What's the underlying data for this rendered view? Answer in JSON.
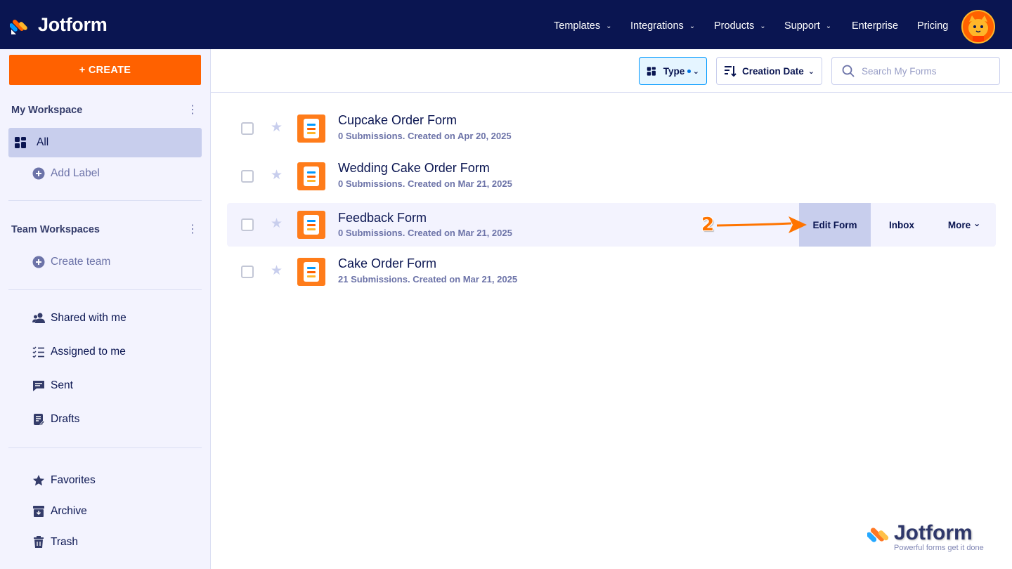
{
  "app": {
    "brand": "Jotform"
  },
  "nav": {
    "items": [
      {
        "label": "Templates",
        "has_dropdown": true
      },
      {
        "label": "Integrations",
        "has_dropdown": true
      },
      {
        "label": "Products",
        "has_dropdown": true
      },
      {
        "label": "Support",
        "has_dropdown": true
      },
      {
        "label": "Enterprise",
        "has_dropdown": false
      },
      {
        "label": "Pricing",
        "has_dropdown": false
      }
    ],
    "avatar_icon": "user-avatar"
  },
  "sidebar": {
    "create_label": "+ CREATE",
    "my_workspace": {
      "title": "My Workspace",
      "all_label": "All",
      "add_label": "Add Label"
    },
    "team_workspaces": {
      "title": "Team Workspaces",
      "create_team_label": "Create team"
    },
    "shared": [
      {
        "label": "Shared with me",
        "icon": "users-icon"
      },
      {
        "label": "Assigned to me",
        "icon": "checklist-icon"
      },
      {
        "label": "Sent",
        "icon": "message-icon"
      },
      {
        "label": "Drafts",
        "icon": "draft-icon"
      }
    ],
    "other": [
      {
        "label": "Favorites",
        "icon": "star-icon"
      },
      {
        "label": "Archive",
        "icon": "archive-icon"
      },
      {
        "label": "Trash",
        "icon": "trash-icon"
      }
    ]
  },
  "toolbar": {
    "type_label": "Type",
    "sort_label": "Creation Date",
    "search_placeholder": "Search My Forms"
  },
  "forms": [
    {
      "title": "Cupcake Order Form",
      "meta": "0 Submissions. Created on Apr 20, 2025"
    },
    {
      "title": "Wedding Cake Order Form",
      "meta": "0 Submissions. Created on Mar 21, 2025"
    },
    {
      "title": "Feedback Form",
      "meta": "0 Submissions. Created on Mar 21, 2025"
    },
    {
      "title": "Cake Order Form",
      "meta": "21 Submissions. Created on Mar 21, 2025"
    }
  ],
  "row_actions": {
    "edit_label": "Edit Form",
    "inbox_label": "Inbox",
    "more_label": "More"
  },
  "annotation": {
    "step_number": "2"
  },
  "watermark": {
    "name": "Jotform",
    "tagline": "Powerful forms get it done"
  },
  "colors": {
    "nav_bg": "#0a1551",
    "accent": "#ff6100",
    "sidebar_bg": "#f3f3fe",
    "active_bg": "#c8ceed"
  }
}
